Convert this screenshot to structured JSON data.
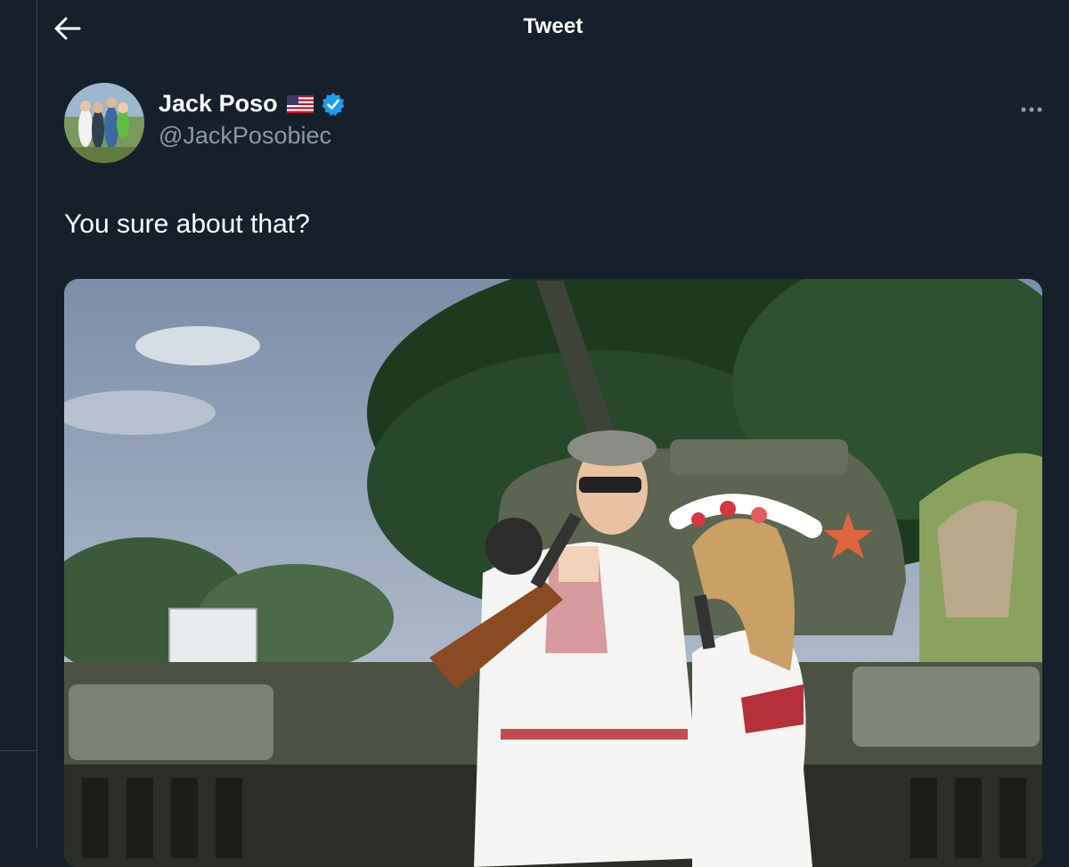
{
  "header": {
    "title": "Tweet",
    "back_icon": "arrow-left-icon"
  },
  "tweet": {
    "author": {
      "display_name": "Jack Poso",
      "flag_emoji": "🇺🇸",
      "handle": "@JackPosobiec",
      "verified": true
    },
    "text": "You sure about that?",
    "more_icon": "more-horizontal-icon"
  },
  "colors": {
    "background": "#15202b",
    "border": "#38444d",
    "secondary_text": "#8b98a5",
    "verified_blue": "#1d9bf0"
  }
}
